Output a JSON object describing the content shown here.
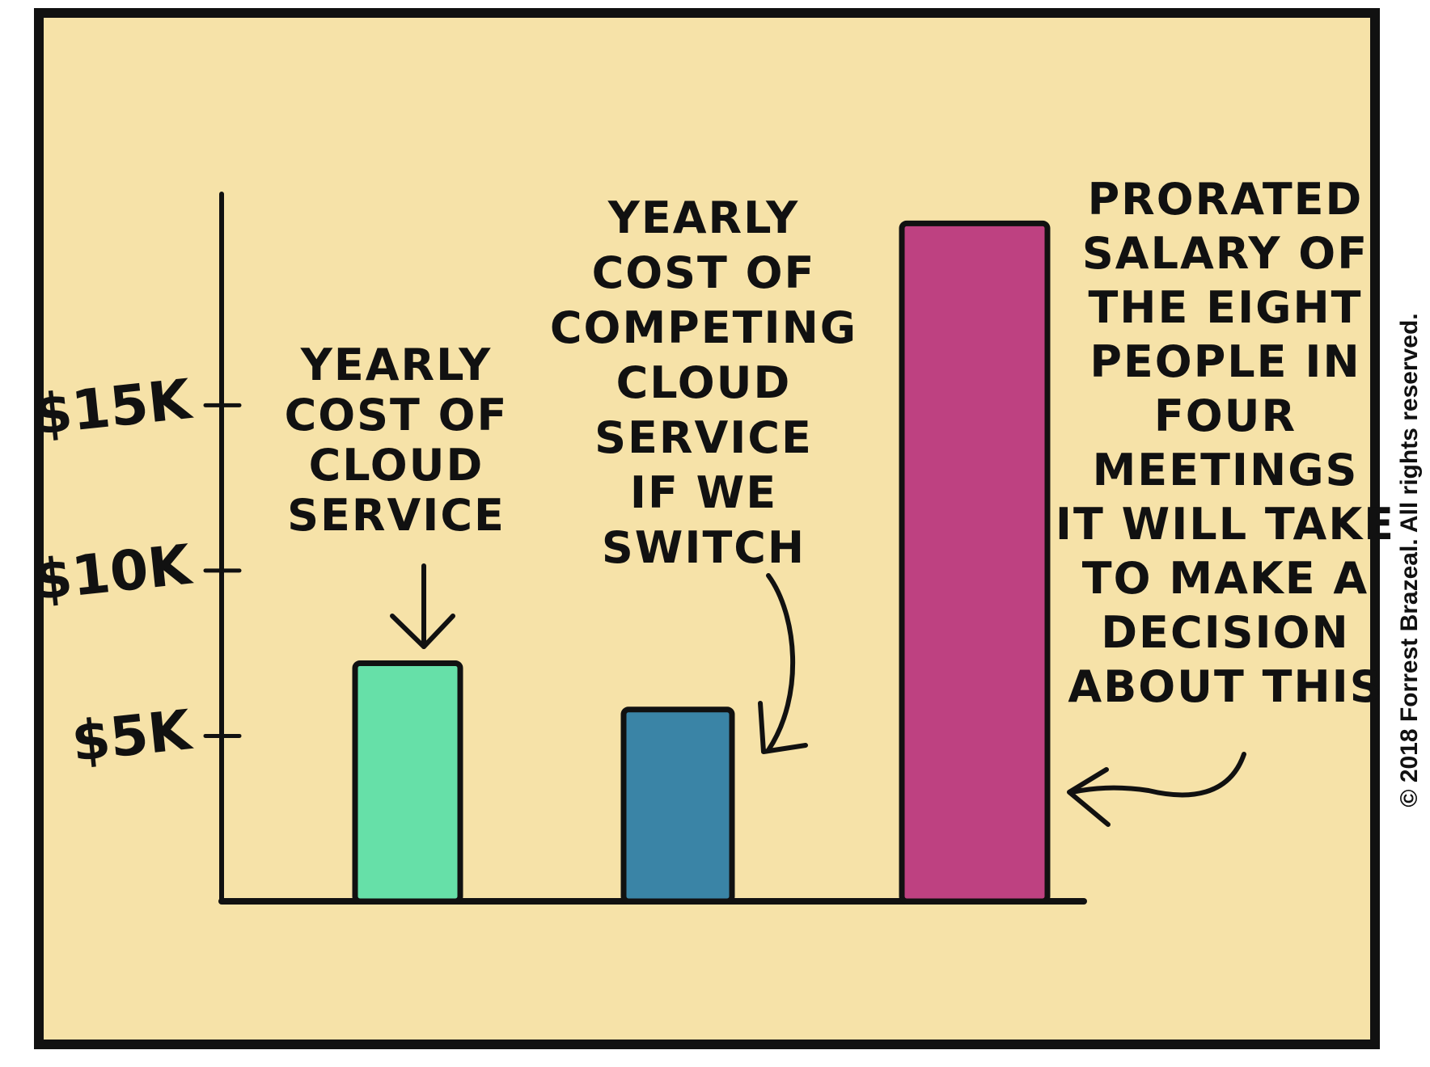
{
  "chart_data": {
    "type": "bar",
    "categories": [
      "YEARLY COST OF CLOUD SERVICE",
      "YEARLY COST OF COMPETING CLOUD SERVICE IF WE SWITCH",
      "PRORATED SALARY OF THE EIGHT PEOPLE IN FOUR MEETINGS IT WILL TAKE TO MAKE A DECISION ABOUT THIS"
    ],
    "values": [
      7200,
      5800,
      20500
    ],
    "colors": [
      "#66e0a8",
      "#3a84a6",
      "#be4181"
    ],
    "ylim": [
      0,
      22000
    ],
    "y_ticks": [
      {
        "value": 5000,
        "label": "$5K"
      },
      {
        "value": 10000,
        "label": "$10K"
      },
      {
        "value": 15000,
        "label": "$15K"
      }
    ],
    "annotations": [
      {
        "lines": [
          "YEARLY",
          "COST OF",
          "CLOUD",
          "SERVICE"
        ]
      },
      {
        "lines": [
          "YEARLY",
          "COST OF",
          "COMPETING",
          "CLOUD",
          "SERVICE",
          "IF WE",
          "SWITCH"
        ]
      },
      {
        "lines": [
          "PRORATED",
          "SALARY OF",
          "THE EIGHT",
          "PEOPLE IN",
          "FOUR",
          "MEETINGS",
          "IT WILL TAKE",
          "TO MAKE A",
          "DECISION",
          "ABOUT THIS"
        ]
      }
    ],
    "title": "",
    "xlabel": "",
    "ylabel": "",
    "grid": false
  },
  "panel": {
    "background": "#f6e2a8",
    "border": "#111111"
  },
  "copyright": "© 2018 Forrest Brazeal. All rights reserved."
}
